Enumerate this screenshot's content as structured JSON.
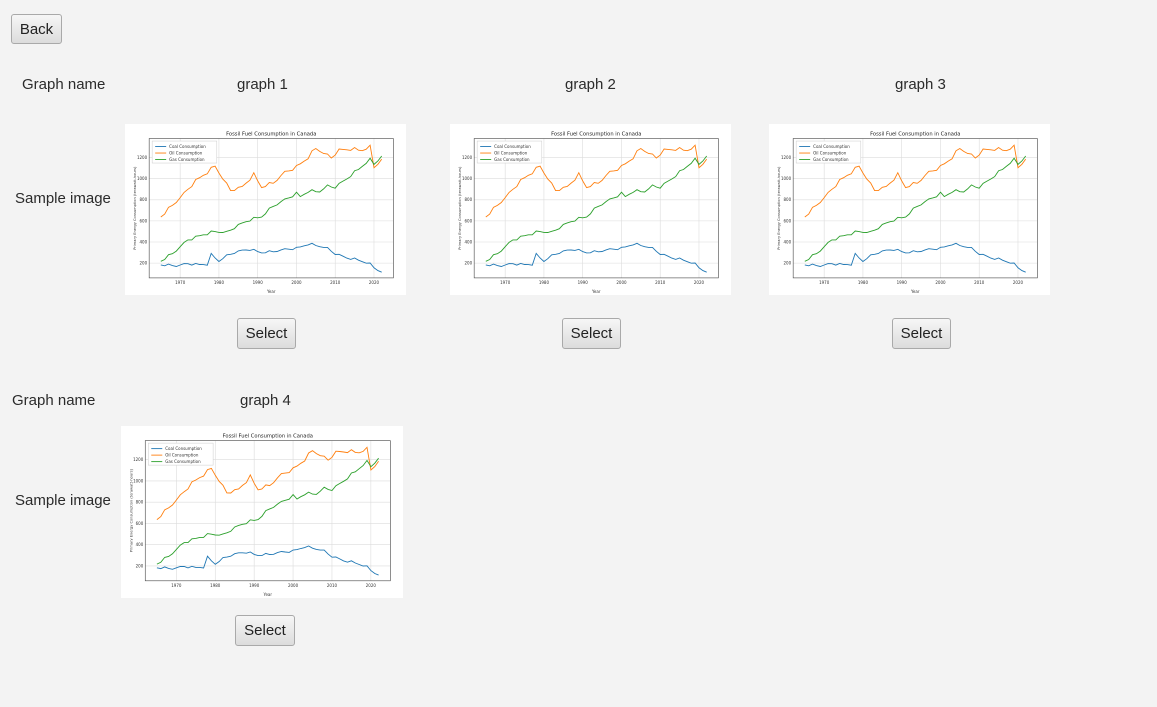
{
  "back_label": "Back",
  "rows": [
    {
      "graph_name_label": "Graph name",
      "sample_image_label": "Sample image",
      "graphs": [
        {
          "name": "graph 1",
          "select_label": "Select"
        },
        {
          "name": "graph 2",
          "select_label": "Select"
        },
        {
          "name": "graph 3",
          "select_label": "Select"
        }
      ]
    },
    {
      "graph_name_label": "Graph name",
      "sample_image_label": "Sample image",
      "graphs": [
        {
          "name": "graph 4",
          "select_label": "Select"
        }
      ]
    }
  ],
  "thumbnail_chart": {
    "title": "Fossil Fuel Consumption in Canada",
    "xlabel": "Year",
    "ylabel": "Primary Energy Consumption (terawatt-hours)",
    "x_ticks": [
      "1970",
      "1980",
      "1990",
      "2000",
      "2010",
      "2020"
    ],
    "y_ticks": [
      "200",
      "400",
      "600",
      "800",
      "1000",
      "1200"
    ],
    "legend": [
      "Coal Consumption",
      "Oil Consumption",
      "Gas Consumption"
    ],
    "colors": {
      "coal": "#1f77b4",
      "oil": "#ff7f0e",
      "gas": "#2ca02c"
    }
  }
}
